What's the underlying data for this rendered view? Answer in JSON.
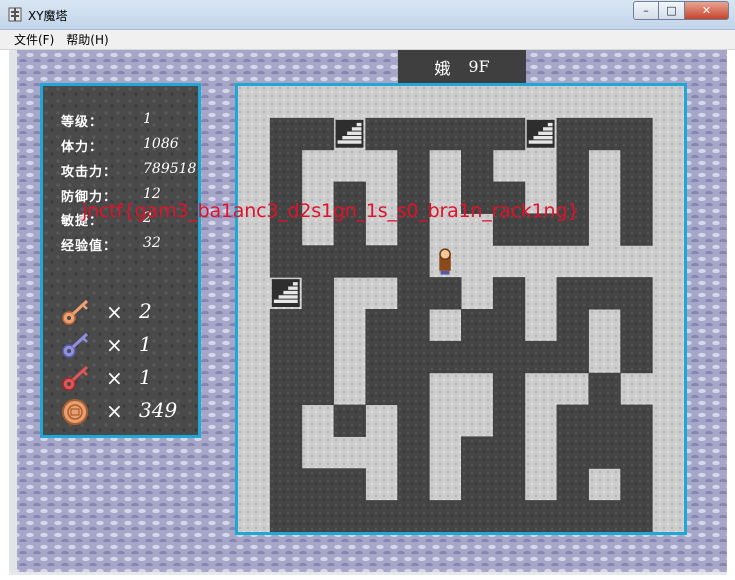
{
  "window": {
    "title": "XY魔塔",
    "minimize_glyph": "–",
    "maximize_glyph": "□",
    "close_glyph": "✕"
  },
  "menu": {
    "items": [
      {
        "label": "文件(F)"
      },
      {
        "label": "帮助(H)"
      }
    ]
  },
  "floor": {
    "name": "娥",
    "level": "9F"
  },
  "status": {
    "stats": [
      {
        "label": "等级：",
        "value": "1"
      },
      {
        "label": "体力：",
        "value": "1086"
      },
      {
        "label": "攻击力：",
        "value": "789518"
      },
      {
        "label": "防御力：",
        "value": "12"
      },
      {
        "label": "敏捷：",
        "value": "2"
      },
      {
        "label": "经验值：",
        "value": "32"
      }
    ],
    "items": [
      {
        "icon": "yellow-key-icon",
        "x": "×",
        "count": "2",
        "color": "#f0a070"
      },
      {
        "icon": "blue-key-icon",
        "x": "×",
        "count": "1",
        "color": "#8f8fe0"
      },
      {
        "icon": "red-key-icon",
        "x": "×",
        "count": "1",
        "color": "#e05555"
      },
      {
        "icon": "gold-coin-icon",
        "x": "×",
        "count": "349",
        "color": "#e8a070"
      }
    ]
  },
  "overlay": {
    "flag": "jnctf{gam3_ba1anc3_d2s1gn_1s_s0_bra1n_rack1ng}",
    "color": "#e0122a"
  },
  "map": {
    "grid": [
      "00000000000000",
      "01121111121110",
      "01000101001010",
      "01010101101010",
      "01010100111010",
      "01111100000000",
      "02100110101110",
      "01101101101010",
      "01101111111010",
      "01101100100100",
      "01010100101110",
      "01000101101110",
      "01110101101010",
      "01111111111110"
    ],
    "legend": {
      "0": "floor",
      "1": "wall",
      "2": "stair"
    },
    "stair_tiles": [
      [
        1,
        2
      ],
      [
        6,
        1
      ],
      [
        7,
        7
      ],
      [
        9,
        12
      ]
    ],
    "hero_tile": [
      5,
      6
    ],
    "colors": {
      "floor": "#cdcdcd",
      "wall": "#444444",
      "accent": "#1fa7d6"
    }
  }
}
